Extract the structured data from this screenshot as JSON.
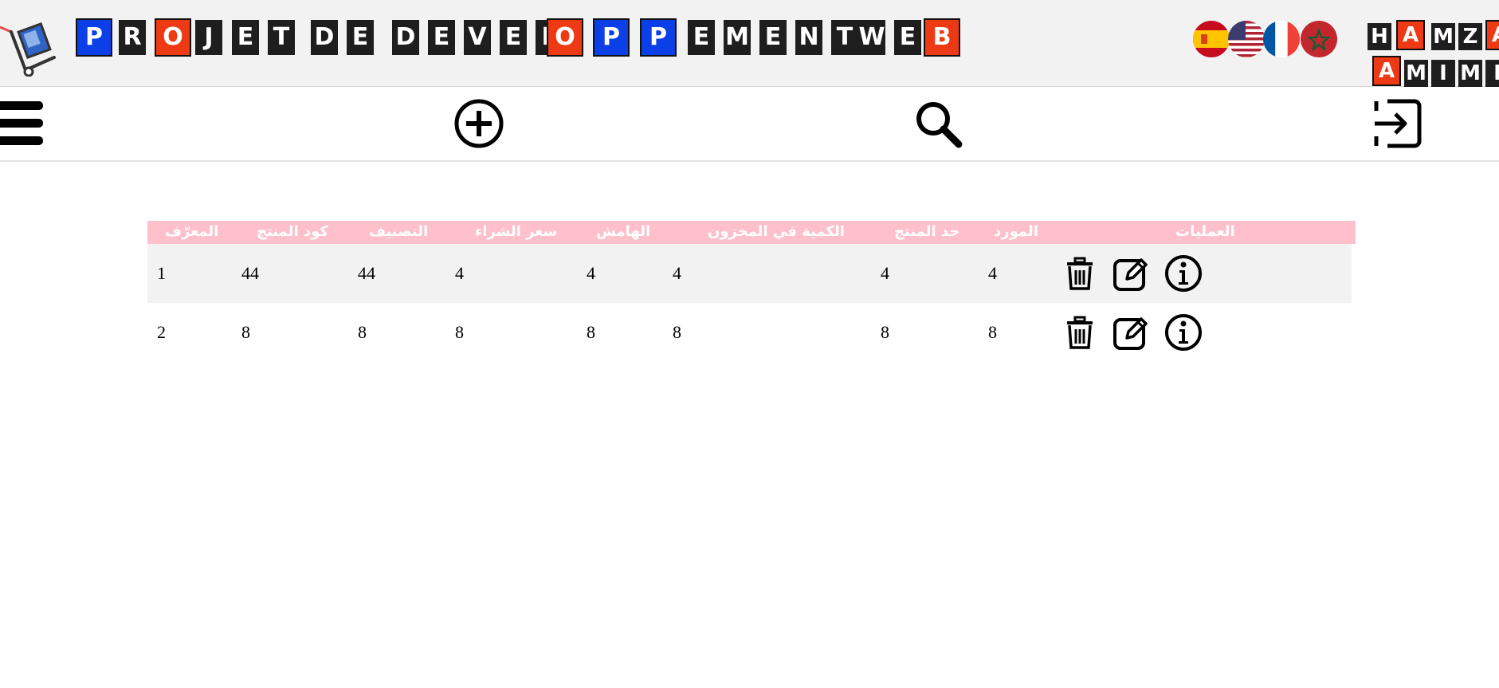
{
  "header": {
    "title_tiles": [
      {
        "ch": "P",
        "style": "blue"
      },
      {
        "ch": "R",
        "style": "dark"
      },
      {
        "ch": "O",
        "style": "red"
      },
      {
        "ch": "J",
        "style": "dark"
      },
      {
        "ch": "E",
        "style": "dark"
      },
      {
        "ch": "T",
        "style": "dark"
      },
      {
        "ch": "D",
        "style": "dark"
      },
      {
        "ch": "E",
        "style": "dark"
      },
      {
        "ch": "D",
        "style": "dark"
      },
      {
        "ch": "E",
        "style": "dark"
      },
      {
        "ch": "V",
        "style": "dark"
      },
      {
        "ch": "E",
        "style": "dark"
      },
      {
        "ch": "L",
        "style": "dark"
      },
      {
        "ch": "O",
        "style": "red"
      },
      {
        "ch": "P",
        "style": "blue"
      },
      {
        "ch": "P",
        "style": "blue"
      },
      {
        "ch": "E",
        "style": "dark"
      },
      {
        "ch": "M",
        "style": "dark"
      },
      {
        "ch": "E",
        "style": "dark"
      },
      {
        "ch": "N",
        "style": "dark"
      },
      {
        "ch": "T",
        "style": "dark"
      },
      {
        "ch": "W",
        "style": "dark"
      },
      {
        "ch": "E",
        "style": "dark"
      },
      {
        "ch": "B",
        "style": "red"
      }
    ],
    "author_line1": [
      {
        "ch": "H",
        "style": "dark"
      },
      {
        "ch": "A",
        "style": "red"
      },
      {
        "ch": "M",
        "style": "dark"
      },
      {
        "ch": "Z",
        "style": "dark"
      },
      {
        "ch": "A",
        "style": "red"
      }
    ],
    "author_line2": [
      {
        "ch": "A",
        "style": "red"
      },
      {
        "ch": "M",
        "style": "dark"
      },
      {
        "ch": "I",
        "style": "dark"
      },
      {
        "ch": "M",
        "style": "dark"
      },
      {
        "ch": "I",
        "style": "dark"
      }
    ],
    "languages": [
      "spain-flag-icon",
      "usa-flag-icon",
      "france-flag-icon",
      "morocco-flag-icon"
    ]
  },
  "toolbar": {
    "menu_icon": "hamburger-menu-icon",
    "add_icon": "add-circle-icon",
    "search_icon": "search-icon",
    "logout_icon": "logout-icon"
  },
  "table": {
    "headers": {
      "id": "المعرّف",
      "code": "كود المنتج",
      "category": "التصنيف",
      "price": "سعر الشراء",
      "margin": "الهامش",
      "stock": "الكمية في المخزون",
      "limit": "حد المنتج",
      "supplier": "المورد",
      "actions": "العمليات"
    },
    "rows": [
      {
        "id": "1",
        "code": "44",
        "category": "44",
        "price": "4",
        "margin": "4",
        "stock": "4",
        "limit": "4",
        "supplier": "4"
      },
      {
        "id": "2",
        "code": "8",
        "category": "8",
        "price": "8",
        "margin": "8",
        "stock": "8",
        "limit": "8",
        "supplier": "8"
      }
    ],
    "action_icons": [
      "delete-icon",
      "edit-icon",
      "info-icon"
    ]
  },
  "colors": {
    "header_bg": "#f2f2f2",
    "table_header_bg": "#ffc0cb",
    "tile_dark": "#1e1e1e",
    "tile_blue": "#0b3fe8",
    "tile_red": "#ee3a14",
    "row_alt_bg": "#f2f2f2"
  }
}
